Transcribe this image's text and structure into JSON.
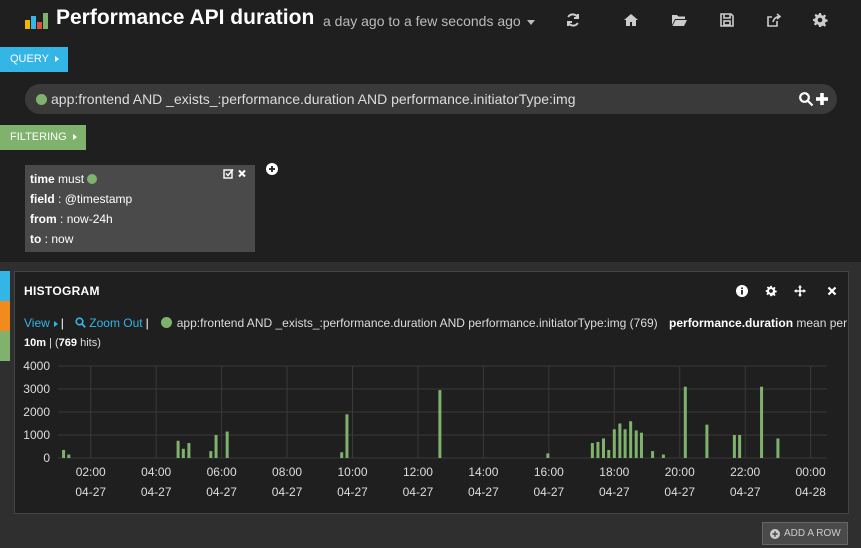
{
  "header": {
    "title": "Performance API duration",
    "timepicker": "a day ago to a few seconds ago",
    "logo_colors": [
      "#f4b400",
      "#33b5e5",
      "#e24d42",
      "#7eb26d"
    ],
    "nav_icons": [
      "refresh-icon",
      "home-icon",
      "folder-open-icon",
      "save-icon",
      "share-icon",
      "gear-icon"
    ]
  },
  "query": {
    "tab_label": "QUERY",
    "tab_color": "#33b5e5",
    "text": "app:frontend AND _exists_:performance.duration AND performance.initiatorType:img",
    "dot_color": "#7eb26d"
  },
  "filtering": {
    "tab_label": "FILTERING",
    "tab_color": "#7eb26d",
    "filter": {
      "type": "time",
      "mandate": "must",
      "field_label": "field",
      "field_value": "@timestamp",
      "from_label": "from",
      "from_value": "now-24h",
      "to_label": "to",
      "to_value": "now"
    }
  },
  "row": {
    "stripe_colors": [
      "#33b5e5",
      "#f28b1e",
      "#7eb26d"
    ]
  },
  "panel": {
    "title": "HISTOGRAM",
    "icons": [
      "info-icon",
      "gear-icon",
      "move-icon",
      "close-icon"
    ],
    "view_label": "View",
    "zoom_out_label": "Zoom Out",
    "legend_query": "app:frontend AND _exists_:performance.duration AND performance.initiatorType:img (769)",
    "metric_field": "performance.duration",
    "metric_desc": "mean per",
    "interval": "10m",
    "hits_count": "769",
    "hits_suffix": "hits)"
  },
  "chart_data": {
    "type": "bar",
    "y_ticks": [
      0,
      1000,
      2000,
      3000,
      4000
    ],
    "ylim": [
      0,
      4000
    ],
    "x_range_hours": [
      1.0,
      24.5
    ],
    "x_ticks": [
      {
        "h": 2,
        "time": "02:00",
        "date": "04-27"
      },
      {
        "h": 4,
        "time": "04:00",
        "date": "04-27"
      },
      {
        "h": 6,
        "time": "06:00",
        "date": "04-27"
      },
      {
        "h": 8,
        "time": "08:00",
        "date": "04-27"
      },
      {
        "h": 10,
        "time": "10:00",
        "date": "04-27"
      },
      {
        "h": 12,
        "time": "12:00",
        "date": "04-27"
      },
      {
        "h": 14,
        "time": "14:00",
        "date": "04-27"
      },
      {
        "h": 16,
        "time": "16:00",
        "date": "04-27"
      },
      {
        "h": 18,
        "time": "18:00",
        "date": "04-27"
      },
      {
        "h": 20,
        "time": "20:00",
        "date": "04-27"
      },
      {
        "h": 22,
        "time": "22:00",
        "date": "04-27"
      },
      {
        "h": 24,
        "time": "00:00",
        "date": "04-28"
      }
    ],
    "bar_color": "#7eb26d",
    "series": [
      {
        "x_hours": [
          1.17,
          1.33,
          4.67,
          4.83,
          5.0,
          5.67,
          5.83,
          6.17,
          9.67,
          9.83,
          12.67,
          15.97,
          17.33,
          17.5,
          17.67,
          17.83,
          18.0,
          18.17,
          18.33,
          18.5,
          18.67,
          18.83,
          19.17,
          19.5,
          20.17,
          20.83,
          21.67,
          21.83,
          22.5,
          23.0
        ],
        "values": [
          350,
          150,
          750,
          400,
          650,
          300,
          1000,
          1150,
          250,
          1900,
          2950,
          200,
          650,
          700,
          850,
          350,
          1250,
          1500,
          1250,
          1600,
          1200,
          1100,
          300,
          150,
          3100,
          1450,
          1000,
          1000,
          3100,
          850
        ]
      }
    ]
  },
  "footer": {
    "add_row_label": "ADD A ROW"
  }
}
